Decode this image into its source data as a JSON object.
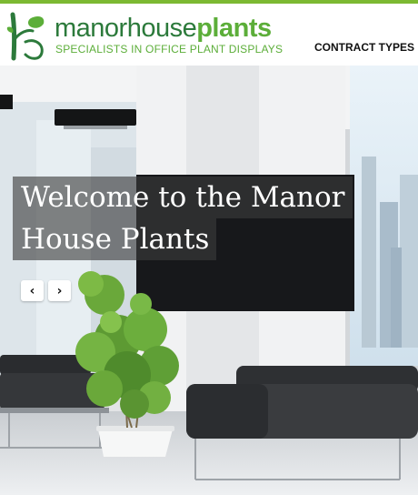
{
  "brand": {
    "name_part1": "manorhouse",
    "name_part2": "plants",
    "tagline": "SPECIALISTS IN OFFICE PLANT DISPLAYS",
    "logo_icon": "plant-leaf-icon",
    "colors": {
      "accent": "#7cb932",
      "dark_green": "#2c7a3b",
      "light_green": "#5cae39"
    }
  },
  "nav": {
    "contract_types": "CONTRACT TYPES"
  },
  "hero": {
    "title_line1": "Welcome to the Manor",
    "title_line2": "House Plants",
    "prev_icon": "chevron-left-icon",
    "prev_glyph": "‹",
    "next_icon": "chevron-right-icon",
    "next_glyph": "›"
  }
}
